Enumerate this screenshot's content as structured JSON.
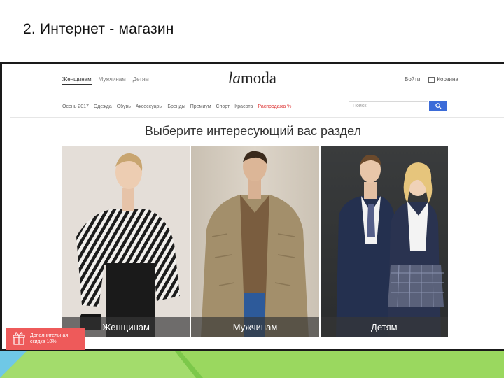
{
  "slide": {
    "title": "2. Интернет - магазин"
  },
  "site": {
    "top_nav": [
      "Женщинам",
      "Мужчинам",
      "Детям"
    ],
    "logo_prefix": "la",
    "logo_suffix": "moda",
    "login": "Войти",
    "cart": "Корзина",
    "categories": [
      "Осень 2017",
      "Одежда",
      "Обувь",
      "Аксессуары",
      "Бренды",
      "Премиум",
      "Спорт",
      "Красота"
    ],
    "sale": "Распродажа %",
    "search_placeholder": "Поиск",
    "headline": "Выберите интересующий вас раздел",
    "panels": [
      "Женщинам",
      "Мужчинам",
      "Детям"
    ],
    "promo_line1": "Дополнительная",
    "promo_line2": "скидка 10%"
  },
  "colors": {
    "accent_blue": "#3b6bd8",
    "sale_red": "#d33333",
    "promo_red": "#ee5a5a",
    "strip_green": "#8fd45a"
  }
}
